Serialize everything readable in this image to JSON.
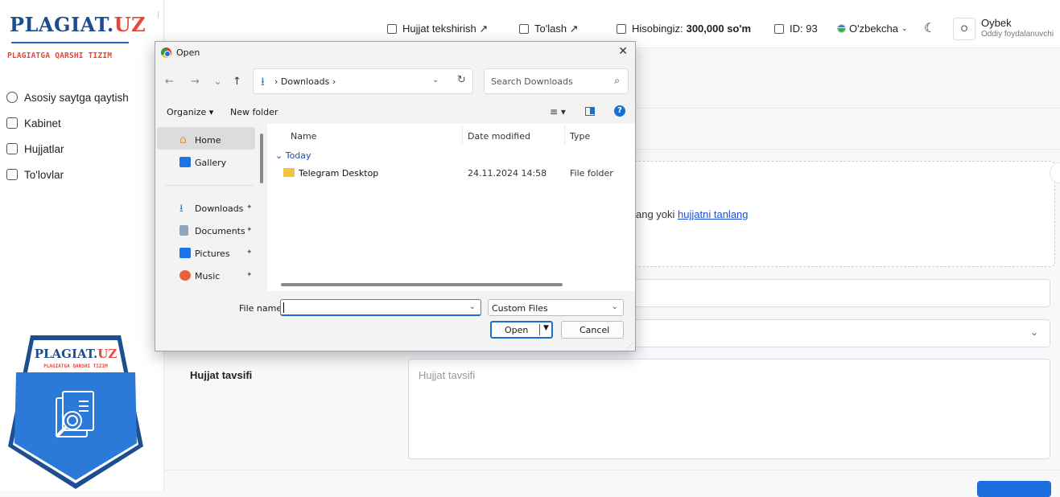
{
  "sidebar": {
    "logo_main": "PLAGIAT.",
    "logo_accent": "UZ",
    "logo_subtitle": "PLAGIATGA QARSHI TIZIM",
    "items": [
      {
        "label": "Asosiy saytga qaytish",
        "icon": "arrow-left-circle-icon"
      },
      {
        "label": "Kabinet",
        "icon": "home-icon"
      },
      {
        "label": "Hujjatlar",
        "icon": "document-icon"
      },
      {
        "label": "To'lovlar",
        "icon": "wallet-icon"
      }
    ],
    "badge": {
      "logo_main": "PLAGIAT.",
      "logo_accent": "UZ",
      "subtitle": "PLAGIATGA QARSHI TIZIM"
    }
  },
  "header": {
    "check_doc": "Hujjat tekshirish ↗",
    "pay": "To'lash ↗",
    "balance_label": "Hisobingiz:",
    "balance_value": "300,000 so'm",
    "id": "ID: 93",
    "language": "O'zbekcha",
    "avatar_letter": "O",
    "user_name": "Oybek",
    "user_role": "Oddiy foydalanuvchi"
  },
  "main": {
    "dropzone_text": "ang yoki",
    "dropzone_link": "hujjatni tanlang",
    "desc_label": "Hujjat tavsifi",
    "desc_placeholder": "Hujjat tavsifi"
  },
  "dialog": {
    "title": "Open",
    "close": "✕",
    "nav": {
      "back": "←",
      "forward": "→",
      "recent": "⌄",
      "up": "↑"
    },
    "path": [
      "Downloads"
    ],
    "search_placeholder": "Search Downloads",
    "organize": "Organize ▾",
    "new_folder": "New folder",
    "nav_items": [
      {
        "label": "Home",
        "icon": "home-icon",
        "pinned": false,
        "selected": true
      },
      {
        "label": "Gallery",
        "icon": "gallery-icon",
        "pinned": false,
        "selected": false
      },
      {
        "label": "Downloads",
        "icon": "download-icon",
        "pinned": true,
        "selected": false
      },
      {
        "label": "Documents",
        "icon": "documents-icon",
        "pinned": true,
        "selected": false
      },
      {
        "label": "Pictures",
        "icon": "pictures-icon",
        "pinned": true,
        "selected": false
      },
      {
        "label": "Music",
        "icon": "music-icon",
        "pinned": true,
        "selected": false
      }
    ],
    "columns": [
      "Name",
      "Date modified",
      "Type"
    ],
    "group": "Today",
    "files": [
      {
        "name": "Telegram Desktop",
        "date": "24.11.2024 14:58",
        "type": "File folder"
      }
    ],
    "file_name_label": "File name:",
    "file_name_value": "",
    "filter_value": "Custom Files",
    "open_button": "Open",
    "cancel_button": "Cancel"
  },
  "colors": {
    "brand_blue": "#1d4e8f",
    "brand_red": "#e8453c",
    "accent": "#1a6fcf"
  }
}
